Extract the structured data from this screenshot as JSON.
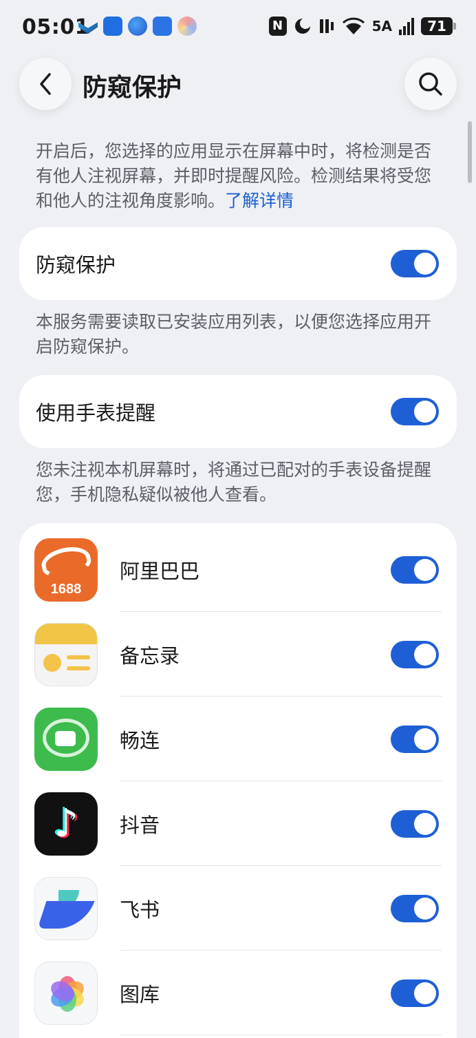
{
  "status_bar": {
    "time": "05:01",
    "notification_icons": [
      "app-notification-icon",
      "hint-bulb-icon",
      "browser-icon",
      "cloud-icon",
      "assistant-icon"
    ],
    "nfc": "N",
    "network": "5A",
    "battery": "71"
  },
  "header": {
    "title": "防窥保护",
    "back_icon": "chevron-left-icon",
    "search_icon": "search-icon"
  },
  "intro": {
    "text": "开启后，您选择的应用显示在屏幕中时，将检测是否有他人注视屏幕，并即时提醒风险。检测结果将受您和他人的注视角度影响。",
    "link": "了解详情"
  },
  "privacy_toggle": {
    "label": "防窥保护",
    "on": true,
    "note": "本服务需要读取已安装应用列表，以便您选择应用开启防窥保护。"
  },
  "watch_toggle": {
    "label": "使用手表提醒",
    "on": true,
    "note": "您未注视本机屏幕时，将通过已配对的手表设备提醒您，手机隐私疑似被他人查看。"
  },
  "apps": [
    {
      "name": "阿里巴巴",
      "icon_text": "1688",
      "icon": "alibaba-1688-icon",
      "on": true
    },
    {
      "name": "备忘录",
      "icon": "notepad-icon",
      "on": true
    },
    {
      "name": "畅连",
      "icon": "meetime-icon",
      "on": true
    },
    {
      "name": "抖音",
      "icon": "douyin-icon",
      "on": true
    },
    {
      "name": "飞书",
      "icon": "feishu-icon",
      "on": true
    },
    {
      "name": "图库",
      "icon": "gallery-icon",
      "on": true
    }
  ],
  "colors": {
    "background": "#eef0f4",
    "accent": "#1f5fd6",
    "card": "#ffffff",
    "secondary_text": "#5b5f66"
  }
}
